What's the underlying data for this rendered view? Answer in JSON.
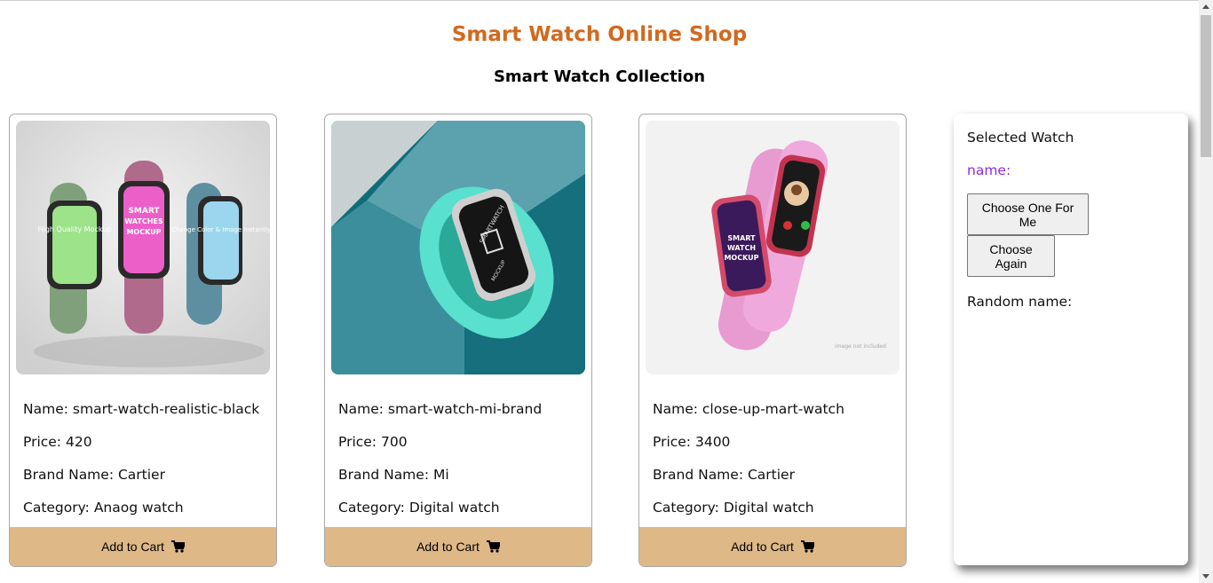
{
  "header": {
    "shop_title": "Smart Watch Online Shop",
    "collection_title": "Smart Watch Collection"
  },
  "labels": {
    "name_prefix": "Name: ",
    "price_prefix": "Price: ",
    "brand_prefix": "Brand Name: ",
    "category_prefix": "Category: ",
    "add_to_cart": "Add to Cart"
  },
  "products": [
    {
      "name": "smart-watch-realistic-black",
      "price": "420",
      "brand": "Cartier",
      "category": "Anaog watch"
    },
    {
      "name": "smart-watch-mi-brand",
      "price": "700",
      "brand": "Mi",
      "category": "Digital watch"
    },
    {
      "name": "close-up-mart-watch",
      "price": "3400",
      "brand": "Cartier",
      "category": "Digital watch"
    }
  ],
  "sidebar": {
    "title": "Selected Watch",
    "name_label": "name:",
    "choose_button": "Choose One For Me",
    "again_button": "Choose Again",
    "random_label": "Random name:"
  },
  "image_text": {
    "mockup_left": "High Quality Mockup",
    "mockup_center_1": "SMART",
    "mockup_center_2": "WATCHES",
    "mockup_center_3": "MOCKUP",
    "mockup_right": "Change Color & Image Instantly",
    "mi_1": "SMARTWATCH",
    "mi_2": "MOCKUP",
    "pink_1": "SMART",
    "pink_2": "WATCH",
    "pink_3": "MOCKUP",
    "pink_note": "image not included"
  },
  "colors": {
    "title": "#d2691e",
    "cart_button": "#deb887",
    "name_label": "#8a2be2"
  }
}
